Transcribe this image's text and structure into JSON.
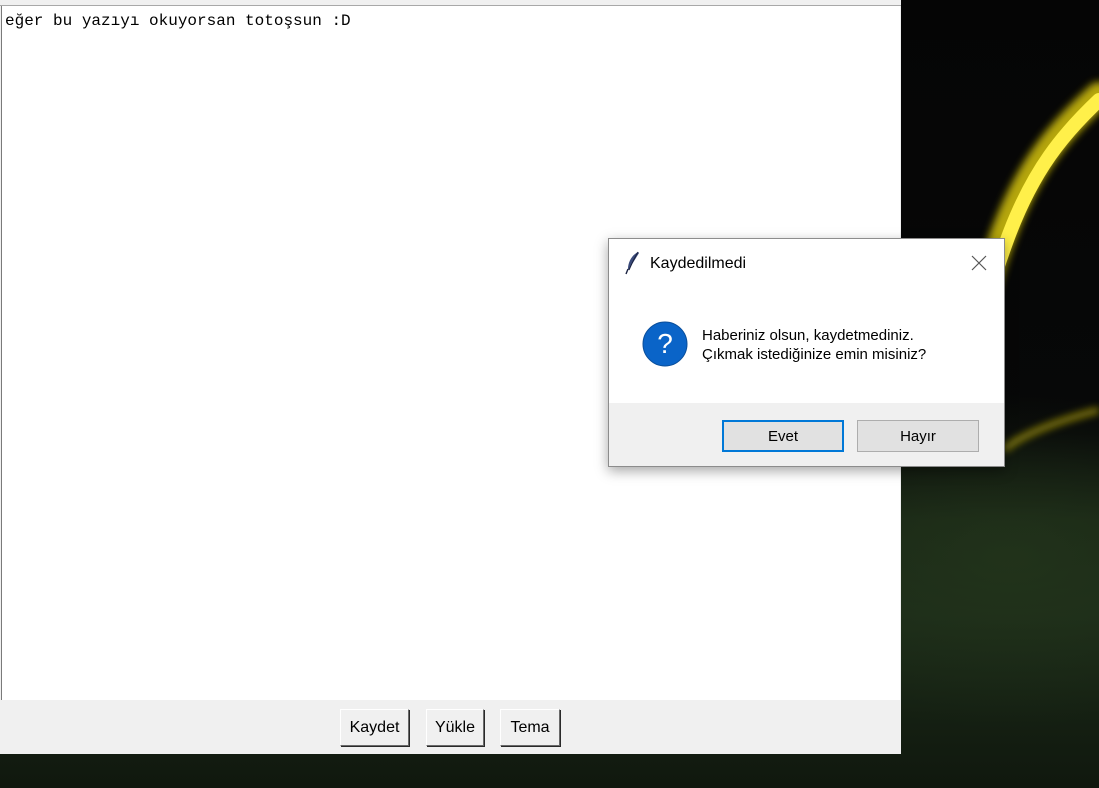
{
  "editor": {
    "content": "eğer bu yazıyı okuyorsan totoşsun :D",
    "buttons": {
      "save_label": "Kaydet",
      "load_label": "Yükle",
      "theme_label": "Tema"
    }
  },
  "dialog": {
    "title": "Kaydedilmedi",
    "icon": "question-icon",
    "message_line1": "Haberiniz olsun, kaydetmediniz.",
    "message_line2": "Çıkmak istediğinize emin misiniz?",
    "yes_label": "Evet",
    "no_label": "Hayır",
    "accent_color": "#0078d7"
  }
}
